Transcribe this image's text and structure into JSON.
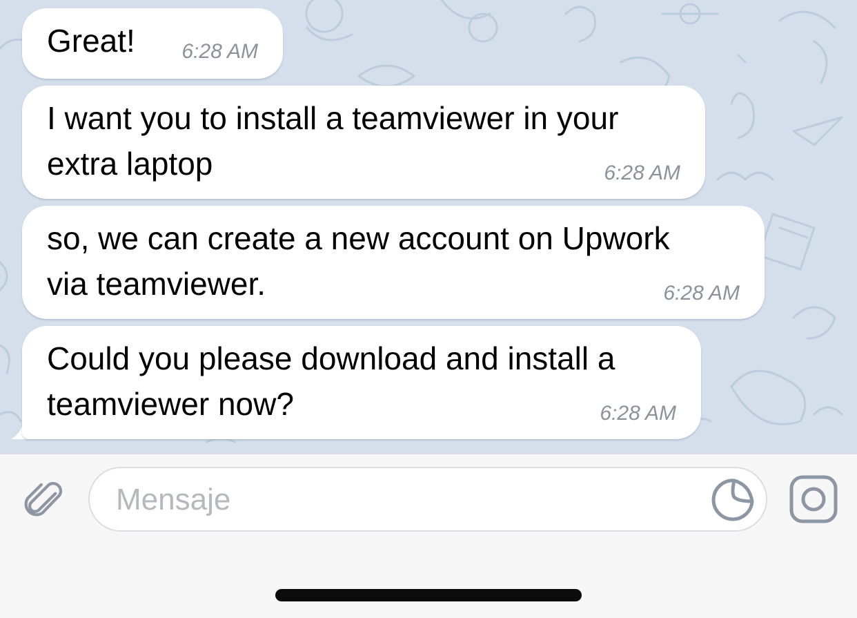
{
  "messages": [
    {
      "text_lines": [
        "Great!"
      ],
      "time": "6:28 AM"
    },
    {
      "text_lines": [
        "I want you to install a teamviewer in your",
        "extra laptop"
      ],
      "time": "6:28 AM"
    },
    {
      "text_lines": [
        "so, we can create a new account on Upwork",
        "via teamviewer."
      ],
      "time": "6:28 AM"
    },
    {
      "text_lines": [
        "Could you please download and install a",
        "teamviewer now?"
      ],
      "time": "6:28 AM"
    }
  ],
  "composer": {
    "placeholder": "Mensaje",
    "attach_icon": "paperclip-icon",
    "sticker_icon": "sticker-icon",
    "camera_icon": "instagram-camera-icon"
  },
  "colors": {
    "chat_background": "#d5dfeb",
    "bubble": "#ffffff",
    "time_text": "#8b929a",
    "icon": "#8e96a3",
    "placeholder": "#b5b8bd"
  }
}
